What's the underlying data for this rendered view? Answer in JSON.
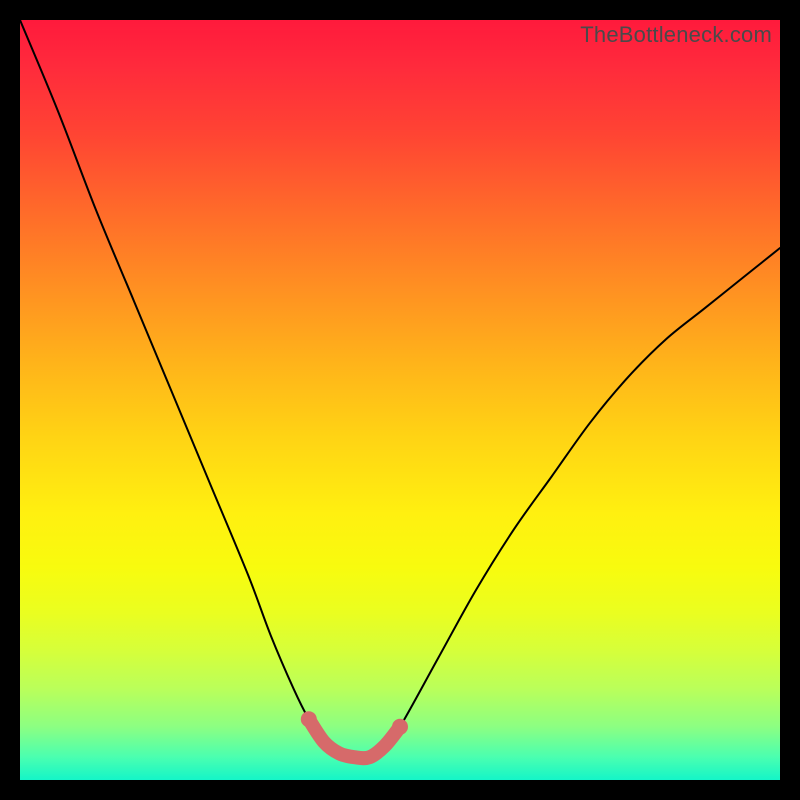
{
  "watermark": "TheBottleneck.com",
  "colors": {
    "curve": "#000000",
    "trough": "#d66a6a"
  },
  "chart_data": {
    "type": "line",
    "title": "",
    "xlabel": "",
    "ylabel": "",
    "xlim": [
      0,
      100
    ],
    "ylim": [
      0,
      100
    ],
    "x": [
      0,
      5,
      10,
      15,
      20,
      25,
      30,
      33,
      36,
      38,
      40,
      42,
      44,
      46,
      48,
      50,
      55,
      60,
      65,
      70,
      75,
      80,
      85,
      90,
      95,
      100
    ],
    "y_curve": [
      100,
      88,
      75,
      63,
      51,
      39,
      27,
      19,
      12,
      8,
      5,
      3.5,
      3,
      3,
      4.5,
      7,
      16,
      25,
      33,
      40,
      47,
      53,
      58,
      62,
      66,
      70
    ],
    "trough_x": [
      38,
      40,
      42,
      44,
      46,
      48,
      50
    ],
    "trough_y": [
      8,
      5,
      3.5,
      3,
      3,
      4.5,
      7
    ],
    "annotations": [],
    "grid": false,
    "legend": false
  }
}
